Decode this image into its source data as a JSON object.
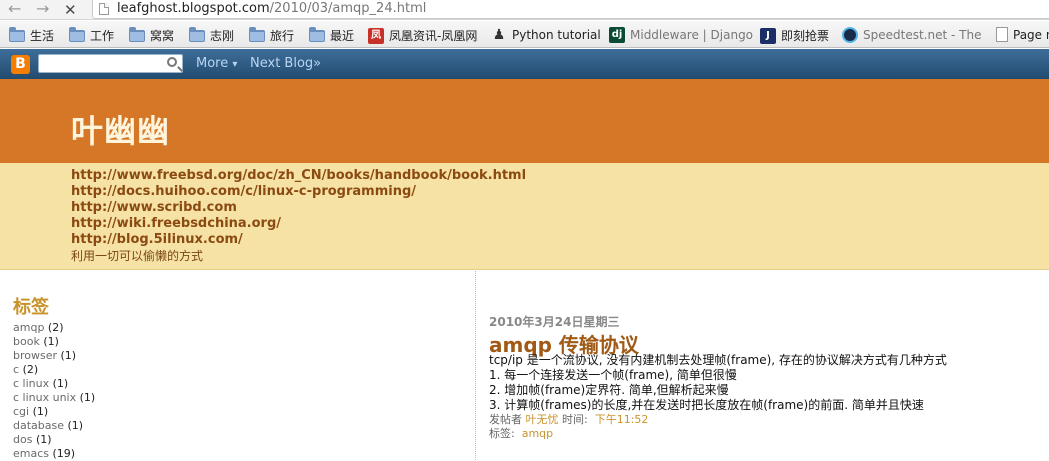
{
  "browser": {
    "url_host": "leafghost.blogspot.com",
    "url_path": "/2010/03/amqp_24.html"
  },
  "bookmarks": [
    {
      "label": "生活",
      "icon": "folder-icon"
    },
    {
      "label": "工作",
      "icon": "folder-icon"
    },
    {
      "label": "窝窝",
      "icon": "folder-icon"
    },
    {
      "label": "志刚",
      "icon": "folder-icon"
    },
    {
      "label": "旅行",
      "icon": "folder-icon"
    },
    {
      "label": "最近",
      "icon": "folder-icon"
    },
    {
      "label": "凤凰资讯-凤凰网",
      "icon": "ifeng-icon"
    },
    {
      "label": "Python tutorial",
      "icon": "python-icon"
    },
    {
      "label": "Middleware | Django",
      "icon": "django-icon"
    },
    {
      "label": "即刻抢票",
      "icon": "ticket-icon"
    },
    {
      "label": "Speedtest.net - The",
      "icon": "speedtest-icon"
    },
    {
      "label": "Page n",
      "icon": "page-icon"
    }
  ],
  "navbar": {
    "logo": "B",
    "search_placeholder": "",
    "more_label": "More",
    "more_arrow": "▾",
    "next_blog_label": "Next Blog»"
  },
  "header": {
    "title": "叶幽幽",
    "links": [
      "http://www.freebsd.org/doc/zh_CN/books/handbook/book.html",
      "http://docs.huihoo.com/c/linux-c-programming/",
      "http://www.scribd.com",
      "http://wiki.freebsdchina.org/",
      "http://blog.5ilinux.com/"
    ],
    "tagline": "利用一切可以偷懒的方式"
  },
  "sidebar": {
    "title": "标签",
    "labels": [
      {
        "name": "amqp",
        "count": "(2)"
      },
      {
        "name": "book",
        "count": "(1)"
      },
      {
        "name": "browser",
        "count": "(1)"
      },
      {
        "name": "c",
        "count": "(2)"
      },
      {
        "name": "c linux",
        "count": "(1)"
      },
      {
        "name": "c linux unix",
        "count": "(1)"
      },
      {
        "name": "cgi",
        "count": "(1)"
      },
      {
        "name": "database",
        "count": "(1)"
      },
      {
        "name": "dos",
        "count": "(1)"
      },
      {
        "name": "emacs",
        "count": "(19)"
      }
    ]
  },
  "post": {
    "date": "2010年3月24日星期三",
    "title": "amqp 传输协议",
    "body": [
      "tcp/ip 是一个流协议, 没有内建机制去处理帧(frame), 存在的协议解决方式有几种方式",
      "1. 每一个连接发送一个帧(frame), 简单但很慢",
      "2. 增加帧(frame)定界符. 简单,但解析起来慢",
      "3. 计算帧(frames)的长度,并在发送时把长度放在帧(frame)的前面. 简单并且快速"
    ],
    "meta_author_prefix": "发帖者",
    "author": "叶无忧",
    "meta_time_prefix": "时间:",
    "time": "下午11:52",
    "meta_label_prefix": "标签:",
    "label": "amqp"
  }
}
